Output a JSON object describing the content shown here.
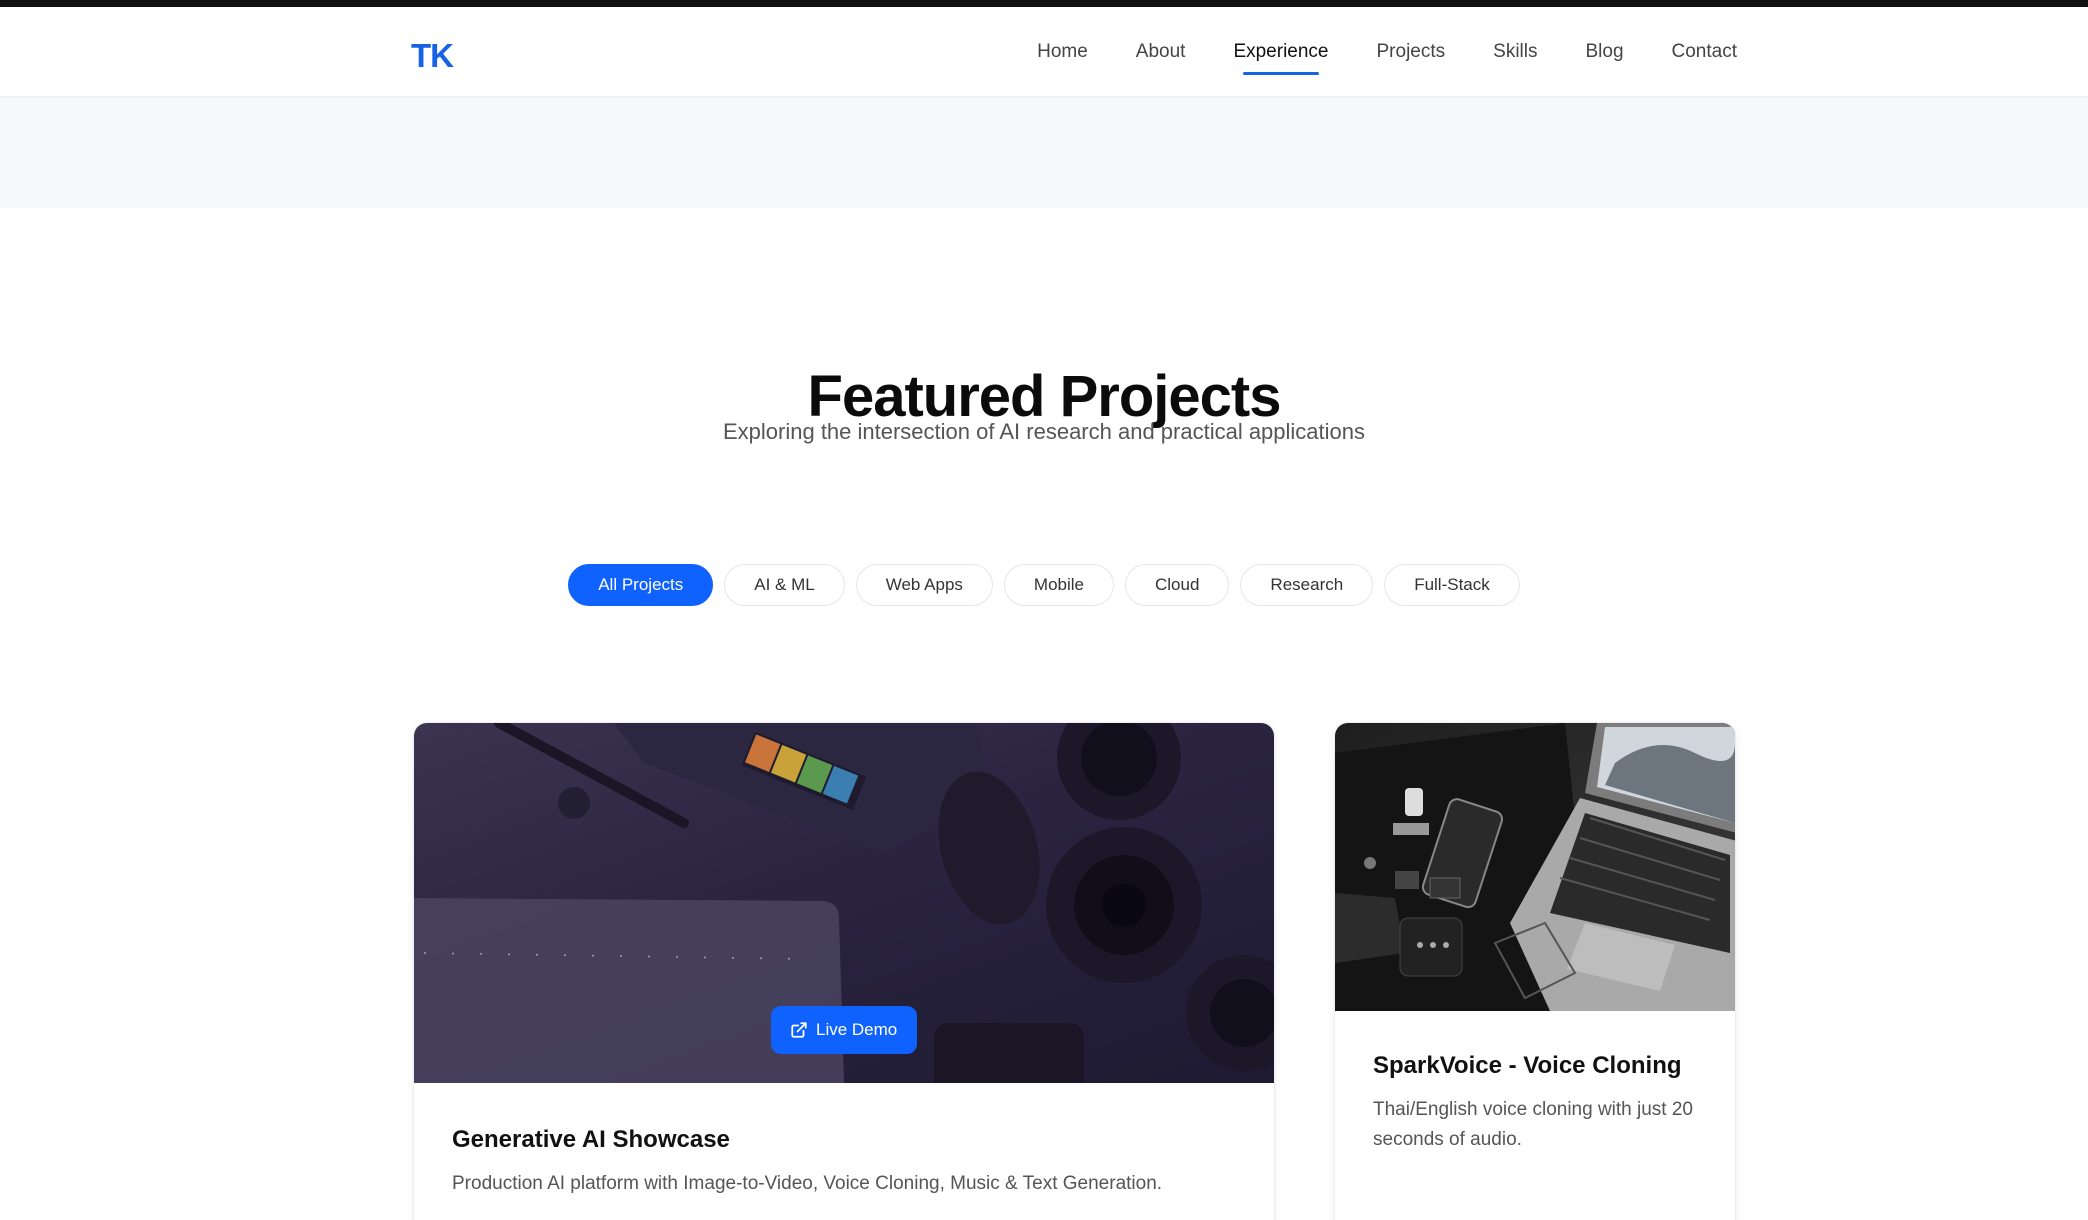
{
  "brand": {
    "logo": "TK",
    "accent": "#1763e6"
  },
  "nav": {
    "items": [
      {
        "label": "Home"
      },
      {
        "label": "About"
      },
      {
        "label": "Experience"
      },
      {
        "label": "Projects"
      },
      {
        "label": "Skills"
      },
      {
        "label": "Blog"
      },
      {
        "label": "Contact"
      }
    ],
    "active": "Experience"
  },
  "section": {
    "title": "Featured Projects",
    "subtitle": "Exploring the intersection of AI research and practical applications"
  },
  "filters": {
    "items": [
      {
        "label": "All Projects"
      },
      {
        "label": "AI & ML"
      },
      {
        "label": "Web Apps"
      },
      {
        "label": "Mobile"
      },
      {
        "label": "Cloud"
      },
      {
        "label": "Research"
      },
      {
        "label": "Full-Stack"
      }
    ],
    "active": "All Projects",
    "active_color": "#0f62fe"
  },
  "projects": [
    {
      "title": "Generative AI Showcase",
      "description": "Production AI platform with Image-to-Video, Voice Cloning, Music & Text Generation.",
      "demo_label": "Live Demo",
      "demo_icon": "external-link-icon"
    },
    {
      "title": "SparkVoice - Voice Cloning",
      "description": "Thai/English voice cloning with just 20 seconds of audio."
    }
  ]
}
